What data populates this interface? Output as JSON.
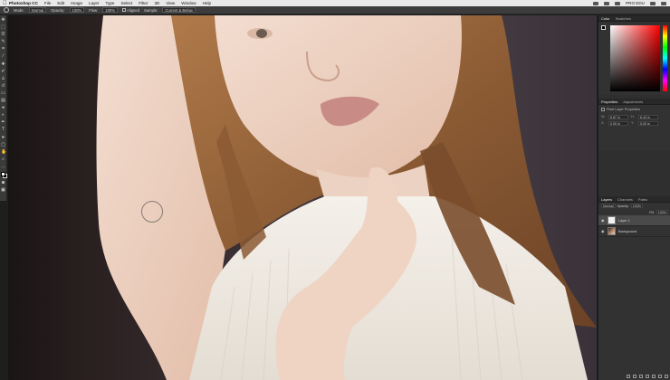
{
  "menubar": {
    "apple": "",
    "items": [
      "Photoshop CC",
      "File",
      "Edit",
      "Image",
      "Layer",
      "Type",
      "Select",
      "Filter",
      "3D",
      "View",
      "Window",
      "Help"
    ],
    "right_label": "PRO EDU"
  },
  "options_bar": {
    "mode_label": "Mode:",
    "mode_value": "Normal",
    "opacity_label": "Opacity:",
    "opacity_value": "100%",
    "flow_label": "Flow:",
    "flow_value": "100%",
    "aligned_label": "Aligned",
    "sample_label": "Sample:",
    "sample_value": "Current & Below"
  },
  "color_panel": {
    "tabs": [
      "Color",
      "Swatches"
    ],
    "hue_color": "#ff0000"
  },
  "properties_panel": {
    "tabs": [
      "Properties",
      "Adjustments"
    ],
    "subtitle": "Pixel Layer Properties",
    "rows": [
      {
        "l1": "W:",
        "v1": "6.67 in",
        "l2": "H:",
        "v2": "6.44 in"
      },
      {
        "l1": "X:",
        "v1": "0.00 in",
        "l2": "Y:",
        "v2": "0.00 in"
      }
    ]
  },
  "layers_panel": {
    "tabs": [
      "Layers",
      "Channels",
      "Paths"
    ],
    "blend_mode": "Normal",
    "opacity_label": "Opacity:",
    "opacity_value": "100%",
    "fill_label": "Fill:",
    "fill_value": "100%",
    "layers": [
      {
        "name": "Layer 1",
        "active": true
      },
      {
        "name": "Background",
        "active": false
      }
    ]
  }
}
